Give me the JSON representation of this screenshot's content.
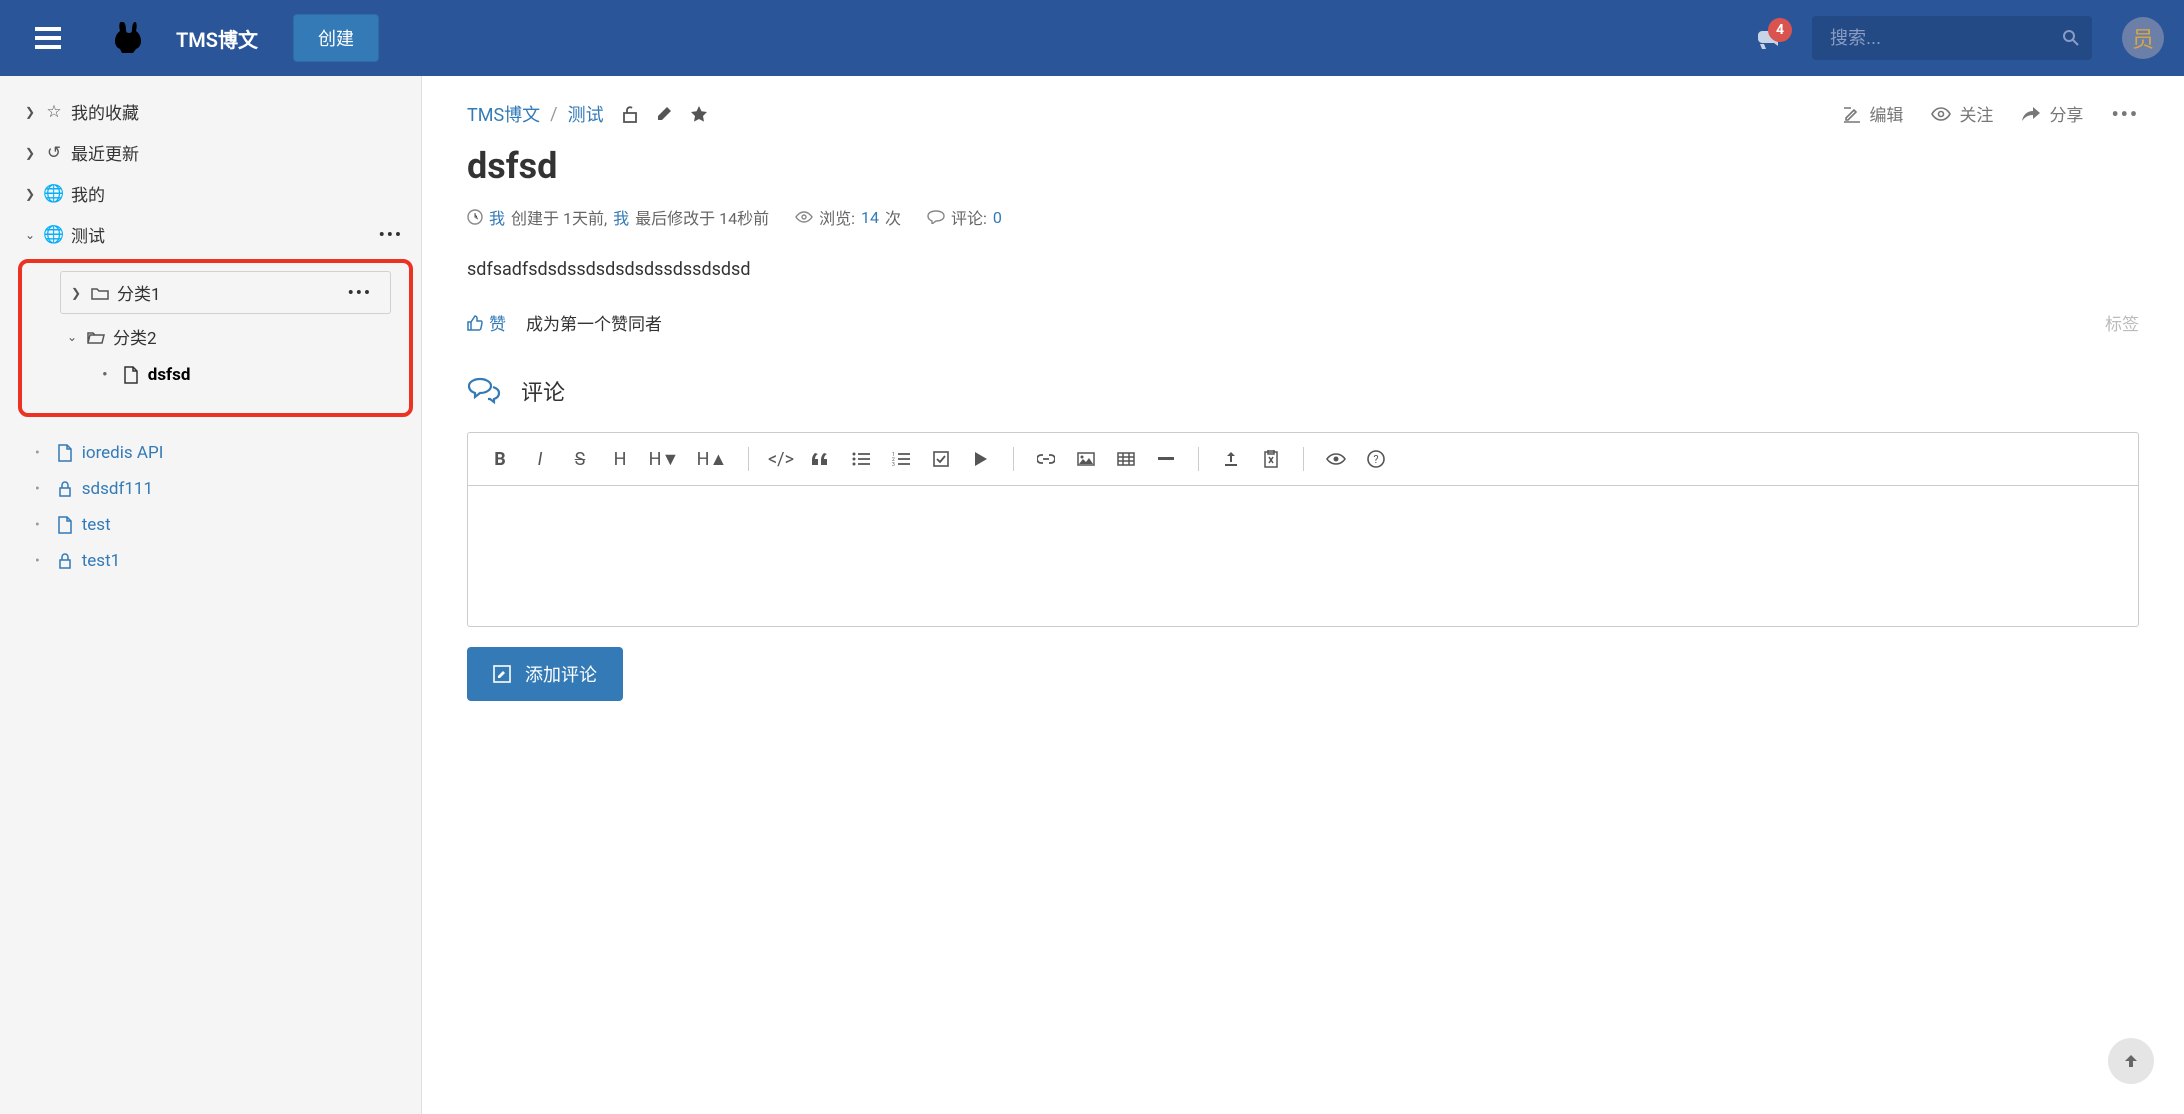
{
  "header": {
    "brand": "TMS博文",
    "create_btn": "创建",
    "search_placeholder": "搜索...",
    "notification_count": "4",
    "avatar_char": "员"
  },
  "sidebar": {
    "favorites": "我的收藏",
    "recent": "最近更新",
    "mine": "我的",
    "test_space": "测试",
    "cat1": "分类1",
    "cat2": "分类2",
    "active_doc": "dsfsd",
    "files": {
      "0": "ioredis API",
      "1": "sdsdf111",
      "2": "test",
      "3": "test1"
    }
  },
  "breadcrumb": {
    "root": "TMS博文",
    "current": "测试"
  },
  "actions": {
    "edit": "编辑",
    "watch": "关注",
    "share": "分享"
  },
  "page": {
    "title": "dsfsd",
    "meta_author1": "我",
    "meta_created": "创建于 1天前,",
    "meta_author2": "我",
    "meta_modified": "最后修改于 14秒前",
    "views_label": "浏览:",
    "views_count": "14",
    "views_suffix": "次",
    "comments_label": "评论:",
    "comments_count": "0",
    "body": "sdfsadfsdsdssdsdsdsdssdssdsdsd",
    "like": "赞",
    "like_prompt": "成为第一个赞同者",
    "tags_label": "标签"
  },
  "comments": {
    "title": "评论",
    "add_btn": "添加评论"
  }
}
